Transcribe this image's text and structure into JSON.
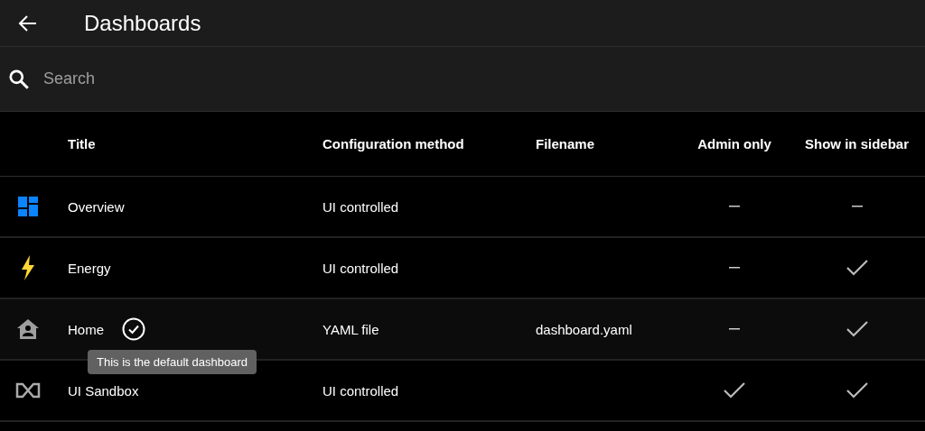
{
  "header": {
    "title": "Dashboards"
  },
  "search": {
    "placeholder": "Search"
  },
  "table": {
    "columns": [
      "Title",
      "Configuration method",
      "Filename",
      "Admin only",
      "Show in sidebar"
    ],
    "rows": [
      {
        "kind": "dashboard",
        "title": "Overview",
        "default": false,
        "method": "UI controlled",
        "admin_only": false,
        "show_in_sidebar": false,
        "highlighted": false
      },
      {
        "kind": "energy",
        "title": "Energy",
        "default": false,
        "method": "UI controlled",
        "admin_only": false,
        "show_in_sidebar": true,
        "highlighted": false
      },
      {
        "kind": "home",
        "title": "Home",
        "default": true,
        "method": "YAML file",
        "filename": "dashboard.yaml",
        "admin_only": false,
        "show_in_sidebar": true,
        "highlighted": true
      },
      {
        "kind": "sandbox",
        "title": "UI Sandbox",
        "default": false,
        "method": "UI controlled",
        "admin_only": true,
        "show_in_sidebar": true,
        "highlighted": false
      }
    ]
  },
  "tooltip": {
    "text": "This is the default dashboard"
  }
}
